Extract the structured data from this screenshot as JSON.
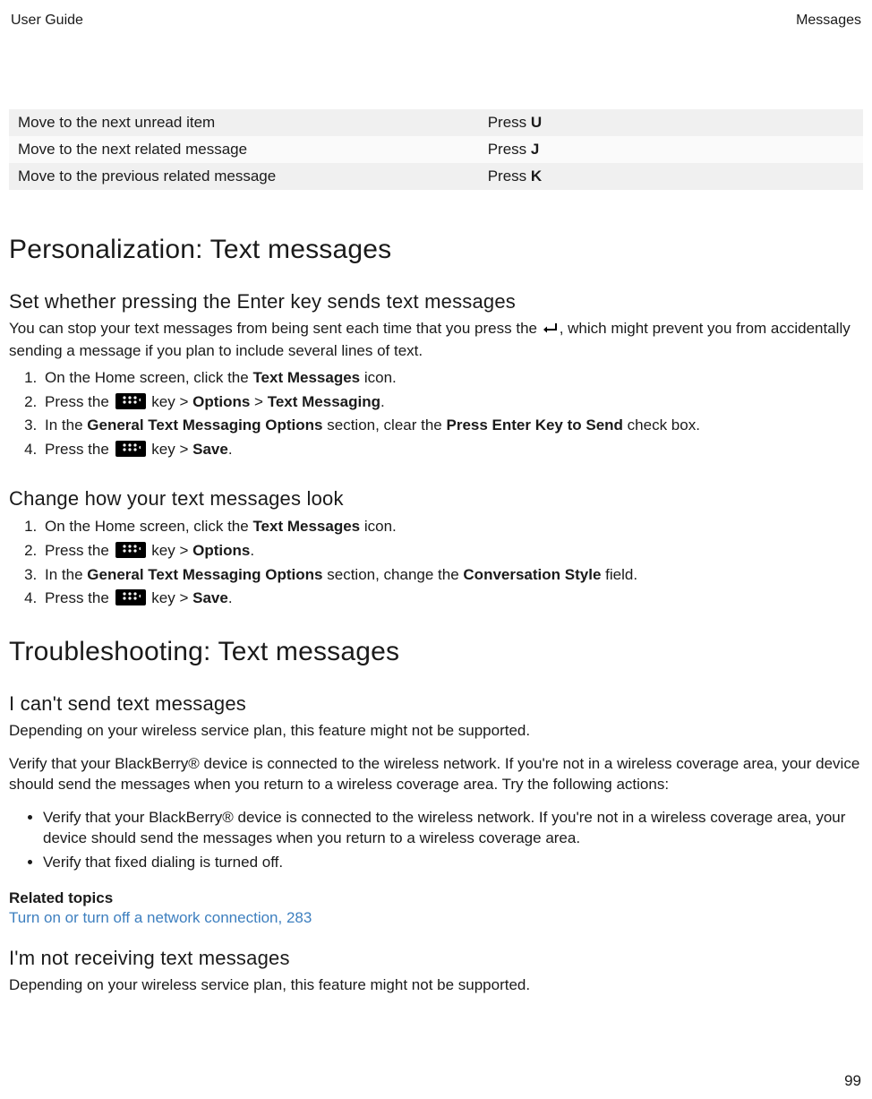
{
  "header": {
    "left": "User Guide",
    "right": "Messages"
  },
  "shortcut_table": {
    "rows": [
      {
        "action": "Move to the next unread item",
        "press_prefix": "Press ",
        "key": "U"
      },
      {
        "action": "Move to the next related message",
        "press_prefix": "Press ",
        "key": "J"
      },
      {
        "action": "Move to the previous related message",
        "press_prefix": "Press ",
        "key": "K"
      }
    ]
  },
  "h1_personalization": "Personalization: Text messages",
  "set_enter": {
    "heading": "Set whether pressing the Enter key sends text messages",
    "intro_pre": "You can stop your text messages from being sent each time that you press the ",
    "intro_post": ", which might prevent you from accidentally sending a message if you plan to include several lines of text.",
    "steps": {
      "s1_pre": "On the Home screen, click the ",
      "s1_bold": "Text Messages",
      "s1_post": " icon.",
      "s2_pre": "Press the ",
      "s2_mid": " key > ",
      "s2_b1": "Options",
      "s2_sep": " > ",
      "s2_b2": "Text Messaging",
      "s2_post": ".",
      "s3_pre": "In the ",
      "s3_b1": "General Text Messaging Options",
      "s3_mid": " section, clear the ",
      "s3_b2": "Press Enter Key to Send",
      "s3_post": " check box.",
      "s4_pre": "Press the ",
      "s4_mid": " key > ",
      "s4_b1": "Save",
      "s4_post": "."
    }
  },
  "change_look": {
    "heading": "Change how your text messages look",
    "steps": {
      "s1_pre": "On the Home screen, click the ",
      "s1_bold": "Text Messages",
      "s1_post": " icon.",
      "s2_pre": "Press the ",
      "s2_mid": " key > ",
      "s2_b1": "Options",
      "s2_post": ".",
      "s3_pre": "In the ",
      "s3_b1": "General Text Messaging Options",
      "s3_mid": " section, change the ",
      "s3_b2": "Conversation Style",
      "s3_post": " field.",
      "s4_pre": "Press the ",
      "s4_mid": " key > ",
      "s4_b1": "Save",
      "s4_post": "."
    }
  },
  "h1_troubleshoot": "Troubleshooting: Text messages",
  "cant_send": {
    "heading": "I can't send text messages",
    "p1": "Depending on your wireless service plan, this feature might not be supported.",
    "p2": "Verify that your BlackBerry® device is connected to the wireless network. If you're not in a wireless coverage area, your device should send the messages when you return to a wireless coverage area. Try the following actions:",
    "bullets": [
      "Verify that your BlackBerry® device is connected to the wireless network. If you're not in a wireless coverage area, your device should send the messages when you return to a wireless coverage area.",
      "Verify that fixed dialing is turned off."
    ],
    "related_heading": "Related topics",
    "related_link": "Turn on or turn off a network connection, 283"
  },
  "not_receiving": {
    "heading": "I'm not receiving text messages",
    "p1": "Depending on your wireless service plan, this feature might not be supported."
  },
  "page_number": "99"
}
